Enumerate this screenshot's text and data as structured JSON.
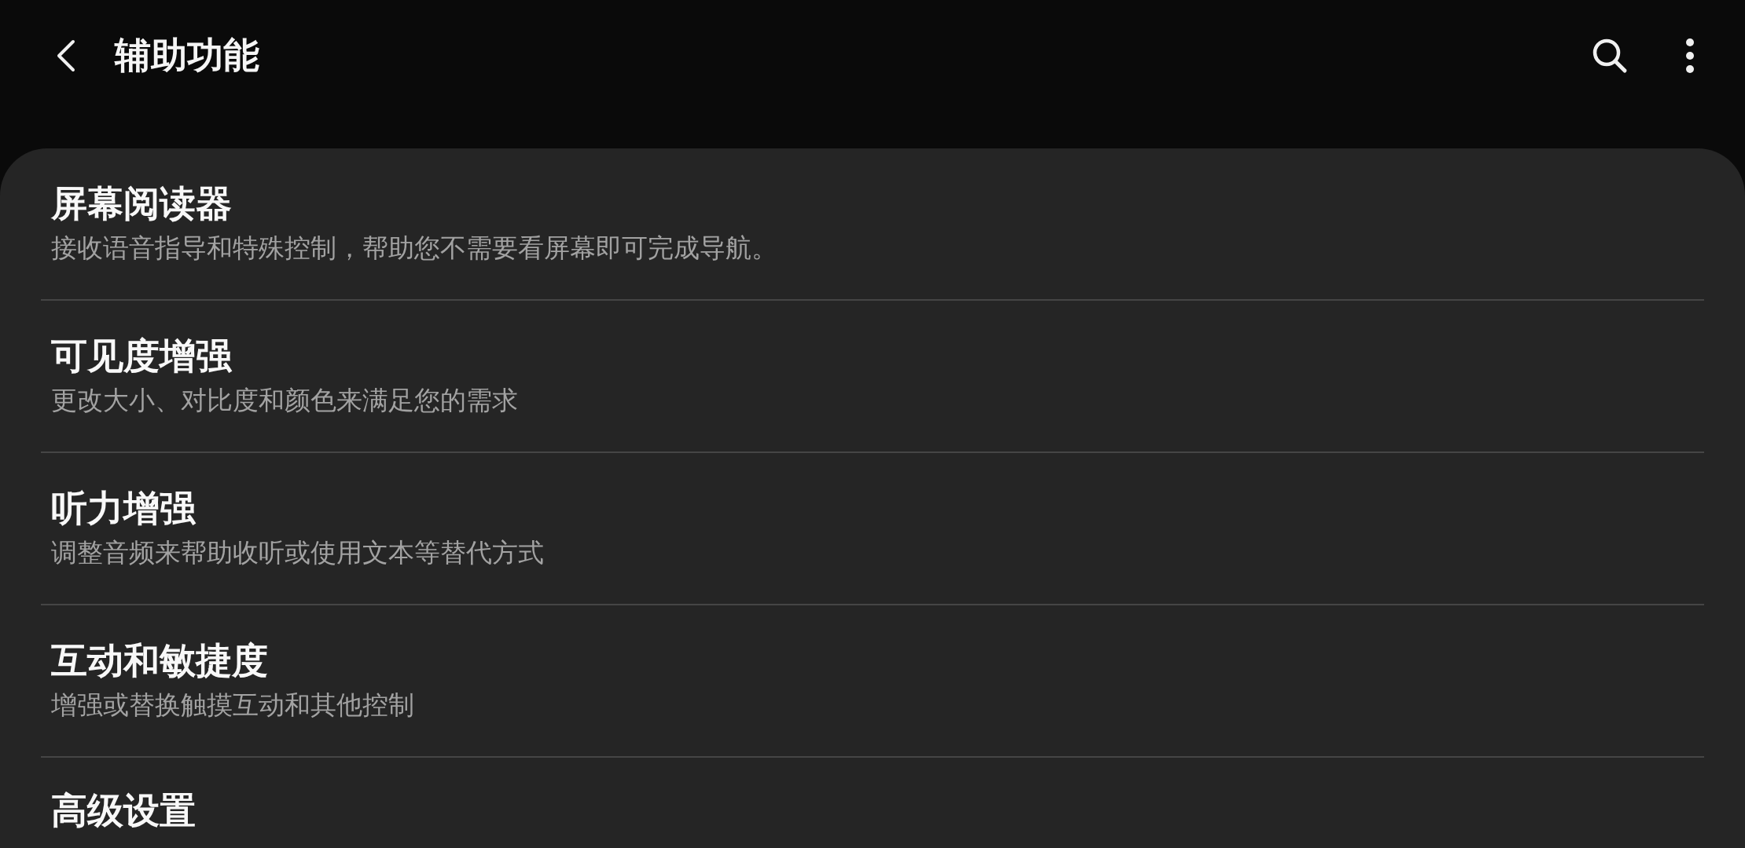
{
  "header": {
    "title": "辅助功能"
  },
  "items": [
    {
      "title": "屏幕阅读器",
      "subtitle": "接收语音指导和特殊控制，帮助您不需要看屏幕即可完成导航。"
    },
    {
      "title": "可见度增强",
      "subtitle": "更改大小、对比度和颜色来满足您的需求"
    },
    {
      "title": "听力增强",
      "subtitle": "调整音频来帮助收听或使用文本等替代方式"
    },
    {
      "title": "互动和敏捷度",
      "subtitle": "增强或替换触摸互动和其他控制"
    },
    {
      "title": "高级设置"
    }
  ]
}
